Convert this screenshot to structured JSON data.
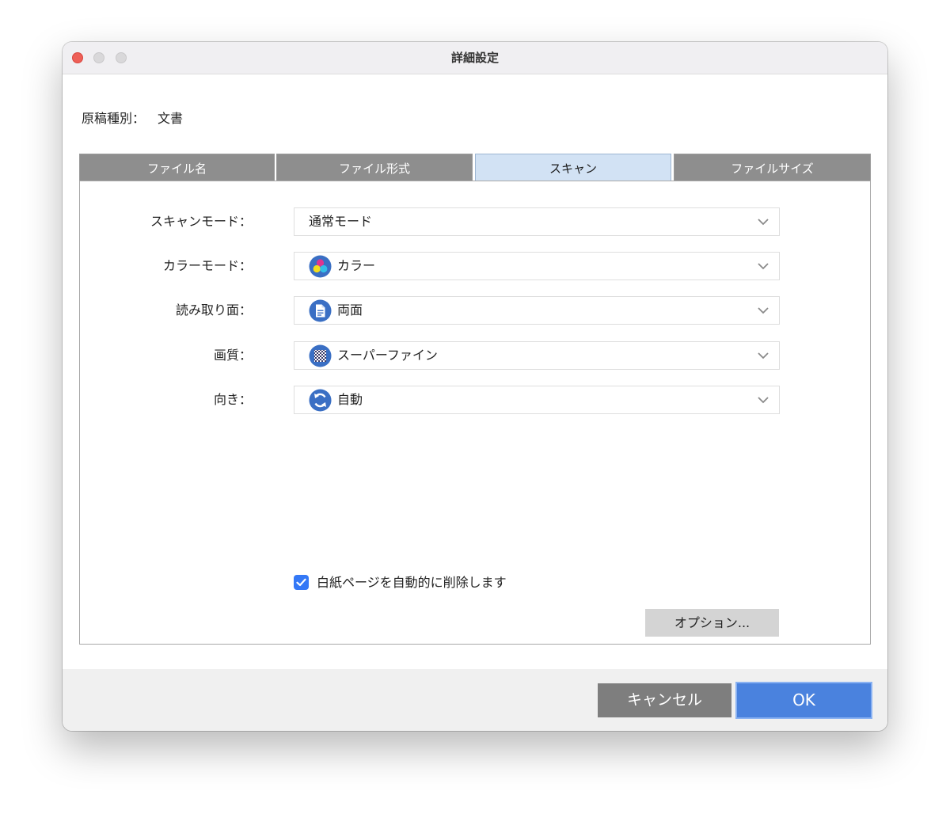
{
  "window": {
    "title": "詳細設定"
  },
  "doc_type": {
    "label": "原稿種別：",
    "value": "文書"
  },
  "tabs": [
    {
      "label": "ファイル名",
      "active": false
    },
    {
      "label": "ファイル形式",
      "active": false
    },
    {
      "label": "スキャン",
      "active": true
    },
    {
      "label": "ファイルサイズ",
      "active": false
    }
  ],
  "settings": {
    "scan_mode": {
      "label": "スキャンモード：",
      "value": "通常モード"
    },
    "color_mode": {
      "label": "カラーモード：",
      "value": "カラー",
      "icon": "color-dots-icon"
    },
    "read_side": {
      "label": "読み取り面：",
      "value": "両面",
      "icon": "document-icon"
    },
    "quality": {
      "label": "画質：",
      "value": "スーパーファイン",
      "icon": "checker-icon"
    },
    "orientation": {
      "label": "向き：",
      "value": "自動",
      "icon": "rotate-icon"
    }
  },
  "blank_page": {
    "label": "白紙ページを自動的に削除します",
    "checked": true
  },
  "buttons": {
    "options": "オプション...",
    "cancel": "キャンセル",
    "ok": "OK"
  },
  "colors": {
    "accent": "#4a82de",
    "tab_active": "#d2e2f4",
    "tab_inactive": "#8e8e8e",
    "close": "#ee5f57"
  }
}
